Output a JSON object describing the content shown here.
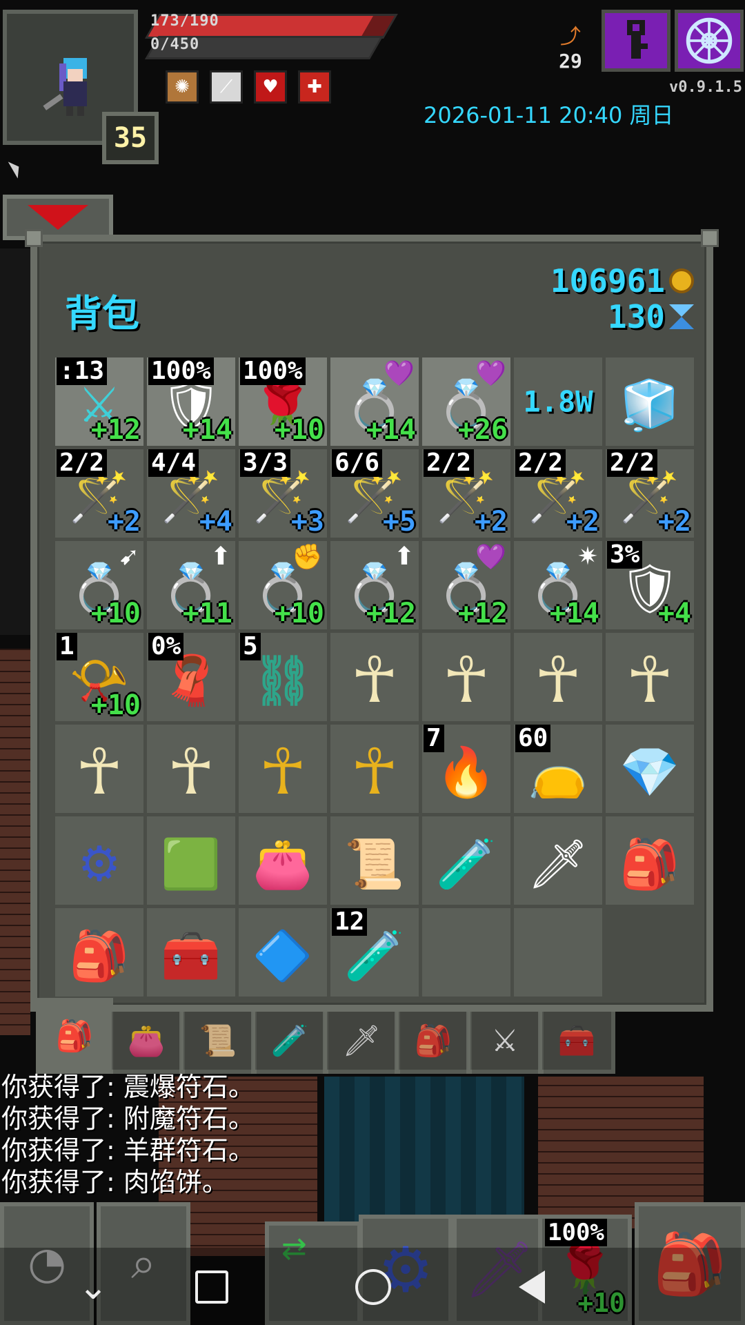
{
  "hud": {
    "hp_text": "173/190",
    "hp_fraction": 0.91,
    "xp_text": "0/450",
    "xp_fraction": 0.0,
    "level": "35",
    "depth": "29",
    "version": "v0.9.1.5",
    "datetime": "2026-01-11 20:40 周日",
    "buffs": [
      {
        "name": "light-buff-icon",
        "color": "#b0763a",
        "glyph": "✺"
      },
      {
        "name": "mind-vision-buff-icon",
        "color": "#d8d8d8",
        "glyph": "⟋"
      },
      {
        "name": "heart-buff-icon",
        "color": "#c01818",
        "glyph": "♥"
      },
      {
        "name": "cross-buff-icon",
        "color": "#c8261e",
        "glyph": "✚"
      }
    ]
  },
  "backpack": {
    "title": "背包",
    "gold": "106961",
    "gems": "130"
  },
  "inventory": {
    "rows": [
      [
        {
          "name": "spear-icon",
          "glyph": "⚔",
          "tl": ":13",
          "br": "+12",
          "br_color": "g",
          "hl": true
        },
        {
          "name": "plate-armor-icon",
          "glyph": "🛡",
          "tl": "100%",
          "br": "+14",
          "br_color": "g",
          "hl": true
        },
        {
          "name": "rose-artifact-icon",
          "glyph": "🌹",
          "tl": "100%",
          "br": "+10",
          "br_color": "g",
          "hl": true
        },
        {
          "name": "ring-icon",
          "glyph": "💍",
          "tr": "💜",
          "br": "+14",
          "br_color": "g",
          "hl": true
        },
        {
          "name": "ring-icon",
          "glyph": "💍",
          "tr": "💜",
          "br": "+26",
          "br_color": "g",
          "hl": true
        },
        {
          "name": "gold-counter",
          "center": "1.8W"
        },
        {
          "name": "magic-bag-icon",
          "glyph": "🧊"
        }
      ],
      [
        {
          "name": "wand-icon",
          "glyph": "🪄",
          "tl": "2/2",
          "br": "+2",
          "br_color": "b"
        },
        {
          "name": "wand-icon",
          "glyph": "🪄",
          "tl": "4/4",
          "br": "+4",
          "br_color": "b"
        },
        {
          "name": "wand-icon",
          "glyph": "🪄",
          "tl": "3/3",
          "br": "+3",
          "br_color": "b"
        },
        {
          "name": "wand-icon",
          "glyph": "🪄",
          "tl": "6/6",
          "br": "+5",
          "br_color": "b"
        },
        {
          "name": "wand-icon",
          "glyph": "🪄",
          "tl": "2/2",
          "br": "+2",
          "br_color": "b"
        },
        {
          "name": "wand-icon",
          "glyph": "🪄",
          "tl": "2/2",
          "br": "+2",
          "br_color": "b"
        },
        {
          "name": "wand-icon",
          "glyph": "🪄",
          "tl": "2/2",
          "br": "+2",
          "br_color": "b"
        }
      ],
      [
        {
          "name": "ring-icon",
          "glyph": "💍",
          "tr": "➹",
          "br": "+10",
          "br_color": "g"
        },
        {
          "name": "ring-icon",
          "glyph": "💍",
          "tr": "⬆",
          "br": "+11",
          "br_color": "g"
        },
        {
          "name": "ring-icon",
          "glyph": "💍",
          "tr": "✊",
          "br": "+10",
          "br_color": "g"
        },
        {
          "name": "ring-icon",
          "glyph": "💍",
          "tr": "⬆",
          "br": "+12",
          "br_color": "g"
        },
        {
          "name": "ring-icon",
          "glyph": "💍",
          "tr": "💜",
          "br": "+12",
          "br_color": "g"
        },
        {
          "name": "ring-icon",
          "glyph": "💍",
          "tr": "✷",
          "br": "+14",
          "br_color": "g"
        },
        {
          "name": "shield-icon",
          "glyph": "🛡",
          "tl": "3%",
          "br": "+4",
          "br_color": "g"
        }
      ],
      [
        {
          "name": "horn-artifact-icon",
          "glyph": "📯",
          "tl": "1",
          "br": "+10",
          "br_color": "g"
        },
        {
          "name": "cloak-artifact-icon",
          "glyph": "🧣",
          "tl": "0%"
        },
        {
          "name": "chain-icon",
          "glyph": "⛓",
          "tl": "5"
        },
        {
          "name": "ankh-icon",
          "glyph": "☥"
        },
        {
          "name": "ankh-icon",
          "glyph": "☥"
        },
        {
          "name": "ankh-icon",
          "glyph": "☥"
        },
        {
          "name": "ankh-icon",
          "glyph": "☥"
        }
      ],
      [
        {
          "name": "ankh-icon",
          "glyph": "☥"
        },
        {
          "name": "ankh-icon",
          "glyph": "☥"
        },
        {
          "name": "blessed-ankh-icon",
          "glyph": "☥"
        },
        {
          "name": "blessed-ankh-icon",
          "glyph": "☥"
        },
        {
          "name": "torch-icon",
          "glyph": "🔥",
          "tl": "7"
        },
        {
          "name": "pouch-icon",
          "glyph": "👝",
          "tl": "60"
        },
        {
          "name": "crystal-chain-icon",
          "glyph": "💎"
        }
      ],
      [
        {
          "name": "gear-icon",
          "glyph": "⚙"
        },
        {
          "name": "emerald-icon",
          "glyph": "🟩"
        },
        {
          "name": "seed-pouch-icon",
          "glyph": "👛"
        },
        {
          "name": "scroll-holder-icon",
          "glyph": "📜"
        },
        {
          "name": "potion-bandolier-icon",
          "glyph": "🧪"
        },
        {
          "name": "wand-holster-icon",
          "glyph": "🗡"
        },
        {
          "name": "red-bag-icon",
          "glyph": "🎒"
        }
      ],
      [
        {
          "name": "backpack-icon",
          "glyph": "🎒"
        },
        {
          "name": "chest-icon",
          "glyph": "🧰"
        },
        {
          "name": "crystal-icon",
          "glyph": "🔷"
        },
        {
          "name": "potion-icon",
          "glyph": "🧪",
          "tl": "12"
        },
        {
          "name": "empty-slot"
        },
        {
          "name": "empty-slot"
        }
      ]
    ]
  },
  "bag_tabs": [
    {
      "name": "bag-tab-backpack",
      "glyph": "🎒",
      "active": true
    },
    {
      "name": "bag-tab-seed-pouch",
      "glyph": "👛"
    },
    {
      "name": "bag-tab-scroll-holder",
      "glyph": "📜"
    },
    {
      "name": "bag-tab-potion-bandolier",
      "glyph": "🧪"
    },
    {
      "name": "bag-tab-wand-holster",
      "glyph": "🗡"
    },
    {
      "name": "bag-tab-red-bag",
      "glyph": "🎒"
    },
    {
      "name": "bag-tab-magic-holster",
      "glyph": "⚔"
    },
    {
      "name": "bag-tab-chest",
      "glyph": "🧰"
    }
  ],
  "log": [
    "你获得了: 震爆符石。",
    "你获得了: 附魔符石。",
    "你获得了: 羊群符石。",
    "你获得了: 肉馅饼。"
  ],
  "toolbar": {
    "quickslot_label": "100%",
    "quickslot_level": "+10"
  }
}
